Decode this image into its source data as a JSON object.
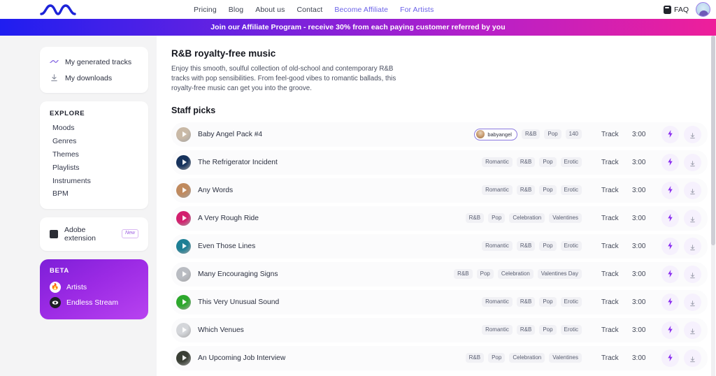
{
  "header": {
    "logo_icon": "wave-logo-icon",
    "nav": [
      {
        "label": "Pricing",
        "accent": false
      },
      {
        "label": "Blog",
        "accent": false
      },
      {
        "label": "About us",
        "accent": false
      },
      {
        "label": "Contact",
        "accent": false
      },
      {
        "label": "Become Affiliate",
        "accent": true
      },
      {
        "label": "For Artists",
        "accent": true
      }
    ],
    "faq_label": "FAQ",
    "faq_icon": "book-icon",
    "avatar_icon": "user-avatar"
  },
  "banner": {
    "text": "Join our Affiliate Program - receive 30% from each paying customer referred by you",
    "gradient_from": "#1f1ef0",
    "gradient_to": "#ee1f9a"
  },
  "sidebar": {
    "top_items": [
      {
        "label": "My generated tracks",
        "icon": "waveform-icon"
      },
      {
        "label": "My downloads",
        "icon": "download-icon"
      }
    ],
    "explore_title": "EXPLORE",
    "explore_items": [
      {
        "label": "Moods"
      },
      {
        "label": "Genres"
      },
      {
        "label": "Themes"
      },
      {
        "label": "Playlists"
      },
      {
        "label": "Instruments"
      },
      {
        "label": "BPM"
      }
    ],
    "adobe": {
      "label": "Adobe extension",
      "badge": "New",
      "icon": "adobe-square-icon"
    },
    "beta": {
      "title": "BETA",
      "items": [
        {
          "label": "Artists",
          "icon": "flame-icon",
          "glyph": "🔥"
        },
        {
          "label": "Endless Stream",
          "icon": "stream-icon",
          "glyph": "◉"
        }
      ]
    }
  },
  "main": {
    "title": "R&B royalty-free music",
    "description": "Enjoy this smooth, soulful collection of old-school and contemporary R&B tracks with pop sensibilities. From feel-good vibes to romantic ballads, this royalty-free music can get you into the groove.",
    "section_title": "Staff picks",
    "tracks": [
      {
        "name": "Baby Angel Pack #4",
        "artist": "babyangel",
        "tags": [
          "R&B",
          "Pop",
          "140"
        ],
        "type": "Track",
        "duration": "3:00",
        "cover_color": "#c9b9a6"
      },
      {
        "name": "The Refrigerator Incident",
        "artist": null,
        "tags": [
          "Romantic",
          "R&B",
          "Pop",
          "Erotic"
        ],
        "type": "Track",
        "duration": "3:00",
        "cover_color": "#16325c"
      },
      {
        "name": "Any Words",
        "artist": null,
        "tags": [
          "Romantic",
          "R&B",
          "Pop",
          "Erotic"
        ],
        "type": "Track",
        "duration": "3:00",
        "cover_color": "#c08a5e"
      },
      {
        "name": "A Very Rough Ride",
        "artist": null,
        "tags": [
          "R&B",
          "Pop",
          "Celebration",
          "Valentines"
        ],
        "type": "Track",
        "duration": "3:00",
        "cover_color": "#d31f6e"
      },
      {
        "name": "Even Those Lines",
        "artist": null,
        "tags": [
          "Romantic",
          "R&B",
          "Pop",
          "Erotic"
        ],
        "type": "Track",
        "duration": "3:00",
        "cover_color": "#1d7f95"
      },
      {
        "name": "Many Encouraging Signs",
        "artist": null,
        "tags": [
          "R&B",
          "Pop",
          "Celebration",
          "Valentines Day"
        ],
        "type": "Track",
        "duration": "3:00",
        "cover_color": "#b9bcc2"
      },
      {
        "name": "This Very Unusual Sound",
        "artist": null,
        "tags": [
          "Romantic",
          "R&B",
          "Pop",
          "Erotic"
        ],
        "type": "Track",
        "duration": "3:00",
        "cover_color": "#2ca82c"
      },
      {
        "name": "Which Venues",
        "artist": null,
        "tags": [
          "Romantic",
          "R&B",
          "Pop",
          "Erotic"
        ],
        "type": "Track",
        "duration": "3:00",
        "cover_color": "#d4d6da"
      },
      {
        "name": "An Upcoming Job Interview",
        "artist": null,
        "tags": [
          "R&B",
          "Pop",
          "Celebration",
          "Valentines"
        ],
        "type": "Track",
        "duration": "3:00",
        "cover_color": "#3a3f35"
      }
    ],
    "action_icons": {
      "boost": "lightning-bolt-icon",
      "download": "download-icon"
    }
  }
}
